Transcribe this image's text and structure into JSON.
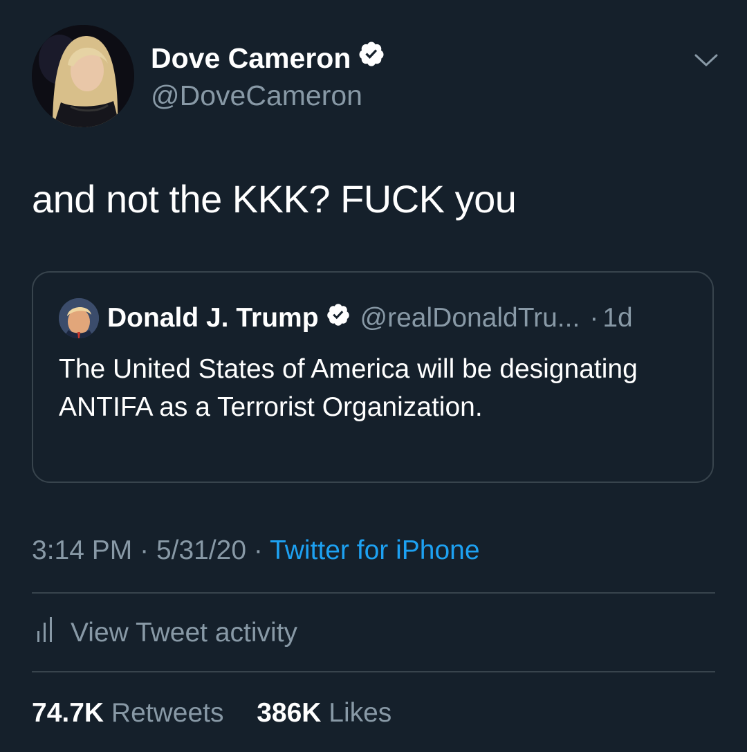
{
  "tweet": {
    "author_name": "Dove Cameron",
    "author_handle": "@DoveCameron",
    "verified_icon": "verified-badge-icon",
    "more_icon": "chevron-down-icon",
    "text": "and not the KKK? FUCK you",
    "timestamp": "3:14 PM",
    "date": "5/31/20",
    "separator": "·",
    "source": "Twitter for iPhone"
  },
  "quoted_tweet": {
    "author_name": "Donald J. Trump",
    "author_handle": "@realDonaldTru...",
    "age": "1d",
    "separator": "·",
    "text": "The United States of America will be designating ANTIFA as a Terrorist Organization."
  },
  "activity": {
    "icon": "bar-chart-icon",
    "label": "View Tweet activity"
  },
  "stats": {
    "retweets_count": "74.7K",
    "retweets_label": "Retweets",
    "likes_count": "386K",
    "likes_label": "Likes"
  },
  "colors": {
    "background": "#15202b",
    "text": "#ffffff",
    "secondary_text": "#8899a6",
    "accent": "#1da1f2",
    "border": "#38444d"
  }
}
